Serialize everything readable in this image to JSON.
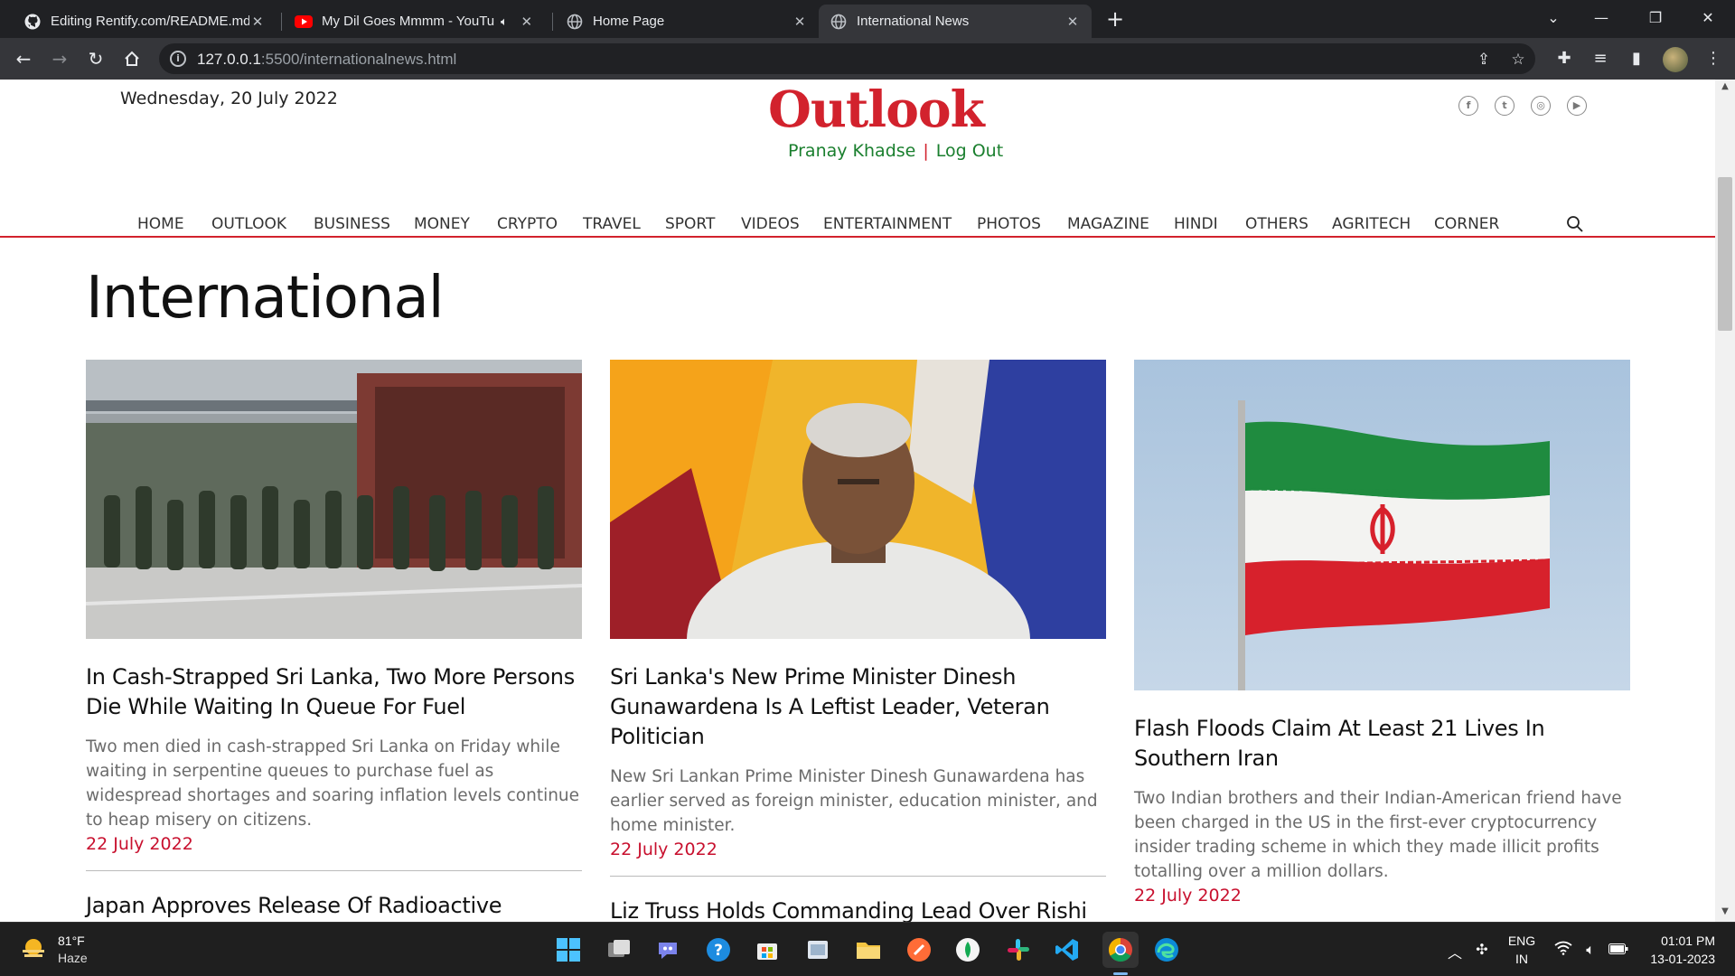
{
  "browser": {
    "tabs": [
      {
        "title": "Editing Rentify.com/README.md",
        "icon": "github-icon",
        "close": "✕"
      },
      {
        "title": "My Dil Goes Mmmm - YouTube",
        "icon": "youtube-icon",
        "close": "✕"
      },
      {
        "title": "Home Page",
        "icon": "globe-icon",
        "close": "✕"
      },
      {
        "title": "International News",
        "icon": "globe-icon",
        "close": "✕"
      }
    ],
    "url_host": "127.0.0.1",
    "url_rest": ":5500/internationalnews.html"
  },
  "header": {
    "date": "Wednesday, 20 July 2022",
    "logo": "Outlook",
    "user_name": "Pranay Khadse",
    "separator": "|",
    "logout": "Log Out",
    "social": [
      "facebook-icon",
      "twitter-icon",
      "instagram-icon",
      "youtube-icon"
    ]
  },
  "nav": {
    "items": [
      "HOME",
      "OUTLOOK",
      "BUSINESS",
      "MONEY",
      "CRYPTO",
      "TRAVEL",
      "SPORT",
      "VIDEOS",
      "ENTERTAINMENT",
      "PHOTOS",
      "MAGAZINE",
      "HINDI",
      "OTHERS",
      "AGRITECH",
      "CORNER"
    ]
  },
  "section": {
    "title": "International"
  },
  "articles": [
    {
      "headline": "In Cash-Strapped Sri Lanka, Two More Persons Die While Waiting In Queue For Fuel",
      "summary": "Two men died in cash-strapped Sri Lanka on Friday while waiting in serpentine queues to purchase fuel as widespread shortages and soaring inflation levels continue to heap misery on citizens.",
      "date": "22 July 2022",
      "next_headline": "Japan Approves Release Of Radioactive"
    },
    {
      "headline": "Sri Lanka's New Prime Minister Dinesh Gunawardena Is A Leftist Leader, Veteran Politician",
      "summary": "New Sri Lankan Prime Minister Dinesh Gunawardena has earlier served as foreign minister, education minister, and home minister.",
      "date": "22 July 2022",
      "next_headline": "Liz Truss Holds Commanding Lead Over Rishi"
    },
    {
      "headline": "Flash Floods Claim At Least 21 Lives In Southern Iran",
      "summary": "Two Indian brothers and their Indian-American friend have been charged in the US in the first-ever cryptocurrency insider trading scheme in which they made illicit profits totalling over a million dollars.",
      "date": "22 July 2022"
    }
  ],
  "taskbar": {
    "weather_temp": "81°F",
    "weather_cond": "Haze",
    "lang_top": "ENG",
    "lang_bottom": "IN",
    "time": "01:01 PM",
    "date": "13-01-2023"
  }
}
